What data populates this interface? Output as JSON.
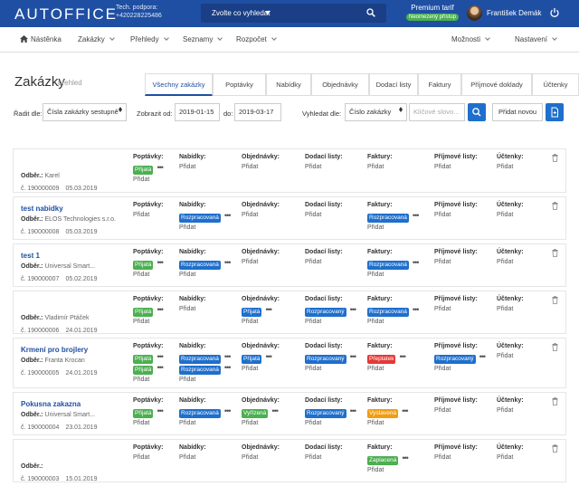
{
  "header": {
    "logo": "AUTOFFICE",
    "support_label": "Tech. podpora:",
    "support_phone": "+420228225486",
    "search_select": "Zvolte co vyhledat",
    "tariff": "Premium tarif",
    "tariff_badge": "Neomezený přístup",
    "user_name": "František Demák"
  },
  "nav": {
    "items": [
      "Nástěnka",
      "Zakázky",
      "Přehledy",
      "Seznamy",
      "Rozpočet"
    ],
    "right": [
      "Možnosti",
      "Nastavení"
    ]
  },
  "page": {
    "title": "Zakázky",
    "subtitle": "přehled"
  },
  "tabs": [
    "Všechny zakázky",
    "Poptávky",
    "Nabídky",
    "Objednávky",
    "Dodací listy",
    "Faktury",
    "Příjmové doklady",
    "Účtenky"
  ],
  "filters": {
    "sort_label": "Řadit dle:",
    "sort_value": "Čísla zakázky sestupně",
    "from_label": "Zobrazit od:",
    "from_value": "2019-01-15",
    "to_label": "do:",
    "to_value": "2019-03-17",
    "search_label": "Vyhledat dle:",
    "search_field": "Číslo zakázky",
    "keyword_placeholder": "Klíčové slovo...",
    "add_new": "Přidat novou"
  },
  "columns": [
    "Poptávky:",
    "Nabídky:",
    "Objednávky:",
    "Dodací listy:",
    "Faktury:",
    "Příjmové listy:",
    "Účtenky:"
  ],
  "add_label": "Přidat",
  "customer_label": "Odběr.:",
  "colors": {
    "primary": "#1f4fa3",
    "green": "#4caf50",
    "blue": "#1f6fcc",
    "red": "#e53935",
    "orange": "#f39c12"
  },
  "orders": [
    {
      "title": "",
      "customer": "Karel",
      "number": "č. 190000009",
      "date": "05.03.2019",
      "cells": [
        [
          {
            "label": "Přijatá",
            "color": "#4caf50"
          }
        ],
        [],
        [],
        [],
        [],
        [],
        []
      ]
    },
    {
      "title": "test nabidky",
      "customer": "ELOS Technologies s.r.o.",
      "number": "č. 190000008",
      "date": "05.03.2019",
      "cells": [
        [],
        [
          {
            "label": "Rozpracovaná",
            "color": "#1f6fcc"
          }
        ],
        [],
        [],
        [
          {
            "label": "Rozpracovaná",
            "color": "#1f6fcc"
          }
        ],
        [],
        []
      ]
    },
    {
      "title": "test 1",
      "customer": "Universal Smart...",
      "number": "č. 190000007",
      "date": "05.02.2019",
      "cells": [
        [
          {
            "label": "Přijatá",
            "color": "#4caf50"
          }
        ],
        [
          {
            "label": "Rozpracovaná",
            "color": "#1f6fcc"
          }
        ],
        [],
        [],
        [
          {
            "label": "Rozpracovaná",
            "color": "#1f6fcc"
          }
        ],
        [],
        []
      ]
    },
    {
      "title": "",
      "customer": "Vladimír Ptáček",
      "number": "č. 190000006",
      "date": "24.01.2019",
      "cells": [
        [
          {
            "label": "Přijatá",
            "color": "#4caf50"
          }
        ],
        [],
        [
          {
            "label": "Přijatá",
            "color": "#1f6fcc"
          }
        ],
        [
          {
            "label": "Rozpracovaný",
            "color": "#1f6fcc"
          }
        ],
        [
          {
            "label": "Rozpracovaná",
            "color": "#1f6fcc"
          }
        ],
        [],
        []
      ]
    },
    {
      "title": "Krmení pro brojlery",
      "customer": "Franta Krocan",
      "number": "č. 190000005",
      "date": "24.01.2019",
      "cells": [
        [
          {
            "label": "Přijatá",
            "color": "#4caf50"
          },
          {
            "label": "Přijatá",
            "color": "#4caf50"
          }
        ],
        [
          {
            "label": "Rozpracovaná",
            "color": "#1f6fcc"
          },
          {
            "label": "Rozpracovaná",
            "color": "#1f6fcc"
          }
        ],
        [
          {
            "label": "Přijatá",
            "color": "#1f6fcc"
          }
        ],
        [
          {
            "label": "Rozpracovaný",
            "color": "#1f6fcc"
          }
        ],
        [
          {
            "label": "Přeplatek",
            "color": "#e53935"
          }
        ],
        [
          {
            "label": "Rozpracovaný",
            "color": "#1f6fcc"
          }
        ],
        []
      ]
    },
    {
      "title": "Pokusna zakazna",
      "customer": "Universal Smart...",
      "number": "č. 190000004",
      "date": "23.01.2019",
      "cells": [
        [
          {
            "label": "Přijatá",
            "color": "#4caf50"
          }
        ],
        [
          {
            "label": "Rozpracovaná",
            "color": "#1f6fcc"
          }
        ],
        [
          {
            "label": "Vyřízená",
            "color": "#4caf50"
          }
        ],
        [
          {
            "label": "Rozpracovaný",
            "color": "#1f6fcc"
          }
        ],
        [
          {
            "label": "Vystavená",
            "color": "#f39c12"
          }
        ],
        [],
        []
      ]
    },
    {
      "title": "",
      "customer": "",
      "number": "č. 190000003",
      "date": "15.01.2019",
      "cells": [
        [],
        [],
        [],
        [],
        [
          {
            "label": "Zaplacená",
            "color": "#4caf50"
          }
        ],
        [],
        []
      ]
    }
  ]
}
